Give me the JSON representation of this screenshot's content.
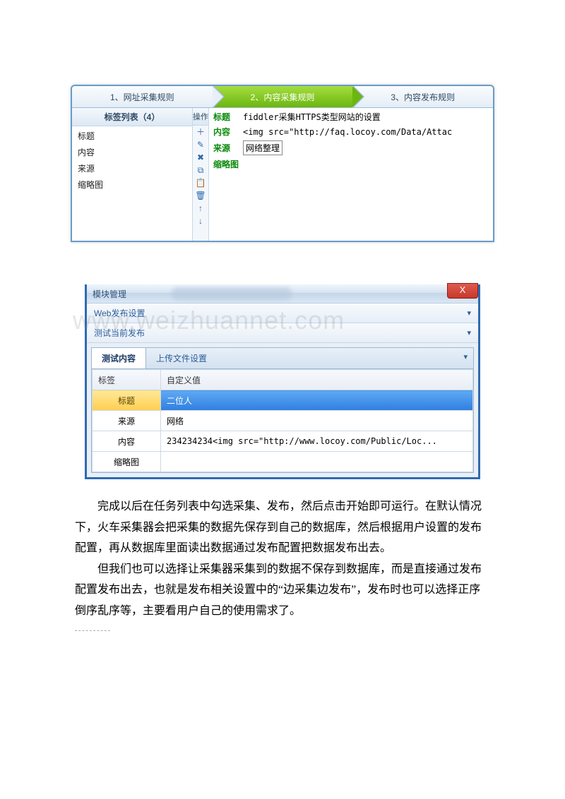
{
  "wizard": {
    "step1": "1、网址采集规则",
    "step2": "2、内容采集规则",
    "step3": "3、内容发布规则"
  },
  "tagcol": {
    "header": "标签列表（4）",
    "items": [
      "标题",
      "内容",
      "来源",
      "缩略图"
    ]
  },
  "opcol": {
    "header": "操作"
  },
  "preview": {
    "rows": [
      {
        "label": "标题",
        "value": "fiddler采集HTTPS类型网站的设置",
        "boxed": false
      },
      {
        "label": "内容",
        "value": "<img src=\"http://faq.locoy.com/Data/Attac",
        "boxed": false
      },
      {
        "label": "来源",
        "value": "网络整理",
        "boxed": true
      },
      {
        "label": "缩略图",
        "value": "",
        "boxed": false
      }
    ]
  },
  "modmgr": {
    "title": "模块管理",
    "close": "X",
    "acc1": "Web发布设置",
    "acc2": "测试当前发布",
    "tabs": {
      "t1": "测试内容",
      "t2": "上传文件设置"
    },
    "gridhead": {
      "c1": "标签",
      "c2": "自定义值"
    },
    "gridrows": [
      {
        "k": "标题",
        "v": "二位人"
      },
      {
        "k": "来源",
        "v": "网络"
      },
      {
        "k": "内容",
        "v": "234234234<img src=\"http://www.locoy.com/Public/Loc..."
      },
      {
        "k": "缩略图",
        "v": ""
      }
    ]
  },
  "watermark": "www.weizhuannet.com",
  "paras": {
    "p1": "完成以后在任务列表中勾选采集、发布，然后点击开始即可运行。在默认情况下，火车采集器会把采集的数据先保存到自己的数据库，然后根据用户设置的发布配置，再从数据库里面读出数据通过发布配置把数据发布出去。",
    "p2": "但我们也可以选择让采集器采集到的数据不保存到数据库，而是直接通过发布配置发布出去，也就是发布相关设置中的“边采集边发布”，发布时也可以选择正序倒序乱序等，主要看用户自己的使用需求了。"
  }
}
